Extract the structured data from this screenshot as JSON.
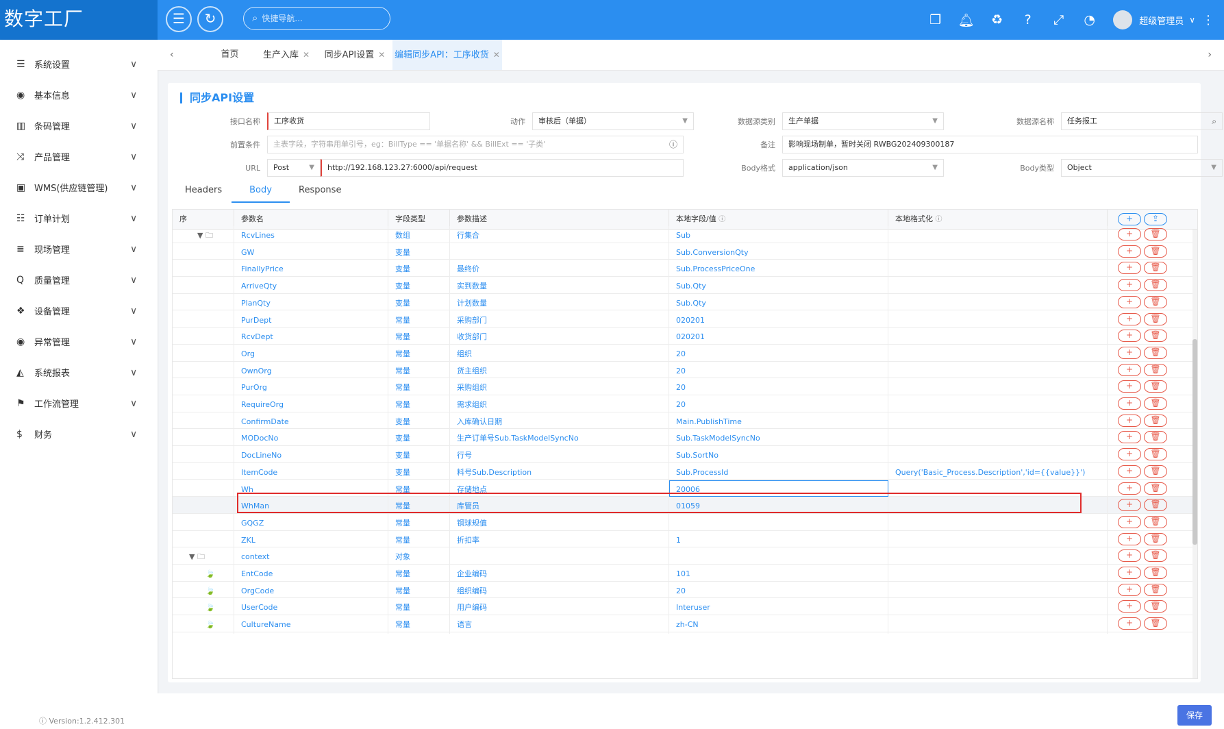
{
  "brand": {
    "title": "数字工厂"
  },
  "topbar": {
    "search_placeholder": "快捷导航...",
    "user_name": "超级管理员"
  },
  "sidebar": {
    "items": [
      {
        "icon": "list-icon",
        "glyph": "☰",
        "label": "系统设置"
      },
      {
        "icon": "compass-icon",
        "glyph": "◉",
        "label": "基本信息"
      },
      {
        "icon": "barcode-icon",
        "glyph": "▥",
        "label": "条码管理"
      },
      {
        "icon": "shuffle-icon",
        "glyph": "⤨",
        "label": "产品管理"
      },
      {
        "icon": "train-icon",
        "glyph": "▣",
        "label": "WMS(供应链管理)"
      },
      {
        "icon": "sliders-icon",
        "glyph": "☷",
        "label": "订单计划"
      },
      {
        "icon": "list-alt-icon",
        "glyph": "≣",
        "label": "现场管理"
      },
      {
        "icon": "search-q-icon",
        "glyph": "Q",
        "label": "质量管理"
      },
      {
        "icon": "cubes-icon",
        "glyph": "❖",
        "label": "设备管理"
      },
      {
        "icon": "warning-circle-icon",
        "glyph": "◉",
        "label": "异常管理"
      },
      {
        "icon": "area-chart-icon",
        "glyph": "◭",
        "label": "系统报表"
      },
      {
        "icon": "sitemap-icon",
        "glyph": "⚑",
        "label": "工作流管理"
      },
      {
        "icon": "dollar-icon",
        "glyph": "$",
        "label": "财务"
      }
    ],
    "version": "Version:1.2.412.301"
  },
  "tabs": [
    {
      "label": "首页",
      "closable": false
    },
    {
      "label": "生产入库",
      "closable": true
    },
    {
      "label": "同步API设置",
      "closable": true
    },
    {
      "label": "编辑同步API：工序收货",
      "closable": true,
      "active": true
    }
  ],
  "page": {
    "title": "同步API设置",
    "form": {
      "api_name_label": "接口名称",
      "api_name_value": "工序收货",
      "action_label": "动作",
      "action_value": "审核后（单据）",
      "ds_type_label": "数据源类别",
      "ds_type_value": "生产单据",
      "ds_name_label": "数据源名称",
      "ds_name_value": "任务报工",
      "precond_label": "前置条件",
      "precond_placeholder": "主表字段，字符串用单引号，eg：BillType == '单据名称' && BillExt == '子类'",
      "remark_label": "备注",
      "remark_value": "影响现场制单，暂时关闭 RWBG202409300187",
      "url_label": "URL",
      "method_value": "Post",
      "url_value": "http://192.168.123.27:6000/api/request",
      "body_format_label": "Body格式",
      "body_format_value": "application/json",
      "body_type_label": "Body类型",
      "body_type_value": "Object"
    },
    "subtabs": [
      "Headers",
      "Body",
      "Response"
    ],
    "columns": [
      "序",
      "参数名",
      "字段类型",
      "参数描述",
      "本地字段/值",
      "本地格式化"
    ],
    "rows": [
      {
        "tree": "▼ 🗀",
        "name": "RcvLines",
        "type": "数组",
        "desc": "行集合",
        "local": "Sub",
        "fmt": ""
      },
      {
        "tree": "",
        "name": "GW",
        "type": "变量",
        "desc": "",
        "local": "Sub.ConversionQty",
        "fmt": ""
      },
      {
        "tree": "",
        "name": "FinallyPrice",
        "type": "变量",
        "desc": "最终价",
        "local": "Sub.ProcessPriceOne",
        "fmt": ""
      },
      {
        "tree": "",
        "name": "ArriveQty",
        "type": "变量",
        "desc": "实到数量",
        "local": "Sub.Qty",
        "fmt": ""
      },
      {
        "tree": "",
        "name": "PlanQty",
        "type": "变量",
        "desc": "计划数量",
        "local": "Sub.Qty",
        "fmt": ""
      },
      {
        "tree": "",
        "name": "PurDept",
        "type": "常量",
        "desc": "采购部门",
        "local": "020201",
        "fmt": ""
      },
      {
        "tree": "",
        "name": "RcvDept",
        "type": "常量",
        "desc": "收货部门",
        "local": "020201",
        "fmt": ""
      },
      {
        "tree": "",
        "name": "Org",
        "type": "常量",
        "desc": "组织",
        "local": "20",
        "fmt": ""
      },
      {
        "tree": "",
        "name": "OwnOrg",
        "type": "常量",
        "desc": "货主组织",
        "local": "20",
        "fmt": ""
      },
      {
        "tree": "",
        "name": "PurOrg",
        "type": "常量",
        "desc": "采购组织",
        "local": "20",
        "fmt": ""
      },
      {
        "tree": "",
        "name": "RequireOrg",
        "type": "常量",
        "desc": "需求组织",
        "local": "20",
        "fmt": ""
      },
      {
        "tree": "",
        "name": "ConfirmDate",
        "type": "变量",
        "desc": "入库确认日期",
        "local": "Main.PublishTime",
        "fmt": ""
      },
      {
        "tree": "",
        "name": "MODocNo",
        "type": "变量",
        "desc": "生产订单号Sub.TaskModelSyncNo",
        "local": "Sub.TaskModelSyncNo",
        "fmt": ""
      },
      {
        "tree": "",
        "name": "DocLineNo",
        "type": "变量",
        "desc": "行号",
        "local": "Sub.SortNo",
        "fmt": ""
      },
      {
        "tree": "",
        "name": "ItemCode",
        "type": "变量",
        "desc": "料号Sub.Description",
        "local": "Sub.ProcessId",
        "fmt": "Query('Basic_Process.Description','id={{value}}')"
      },
      {
        "tree": "",
        "name": "Wh",
        "type": "常量",
        "desc": "存储地点",
        "local": "20006",
        "fmt": ""
      },
      {
        "tree": "",
        "name": "WhMan",
        "type": "常量",
        "desc": "库管员",
        "local": "01059",
        "fmt": ""
      },
      {
        "tree": "",
        "name": "GQGZ",
        "type": "常量",
        "desc": "钢球规值",
        "local": "",
        "fmt": ""
      },
      {
        "tree": "",
        "name": "ZKL",
        "type": "常量",
        "desc": "折扣率",
        "local": "1",
        "fmt": ""
      },
      {
        "tree": "▼ 🗀",
        "name": "context",
        "type": "对象",
        "desc": "",
        "local": "",
        "fmt": ""
      },
      {
        "tree": "🍃",
        "name": "EntCode",
        "type": "常量",
        "desc": "企业编码",
        "local": "101",
        "fmt": ""
      },
      {
        "tree": "🍃",
        "name": "OrgCode",
        "type": "常量",
        "desc": "组织编码",
        "local": "20",
        "fmt": ""
      },
      {
        "tree": "🍃",
        "name": "UserCode",
        "type": "常量",
        "desc": "用户编码",
        "local": "Interuser",
        "fmt": ""
      },
      {
        "tree": "🍃",
        "name": "CultureName",
        "type": "常量",
        "desc": "语言",
        "local": "zh-CN",
        "fmt": ""
      }
    ],
    "save_label": "保存"
  },
  "colors": {
    "primary": "#2b8ef0",
    "brand": "#1473ce",
    "danger": "#e75a4a",
    "highlight": "#e02b2b"
  }
}
